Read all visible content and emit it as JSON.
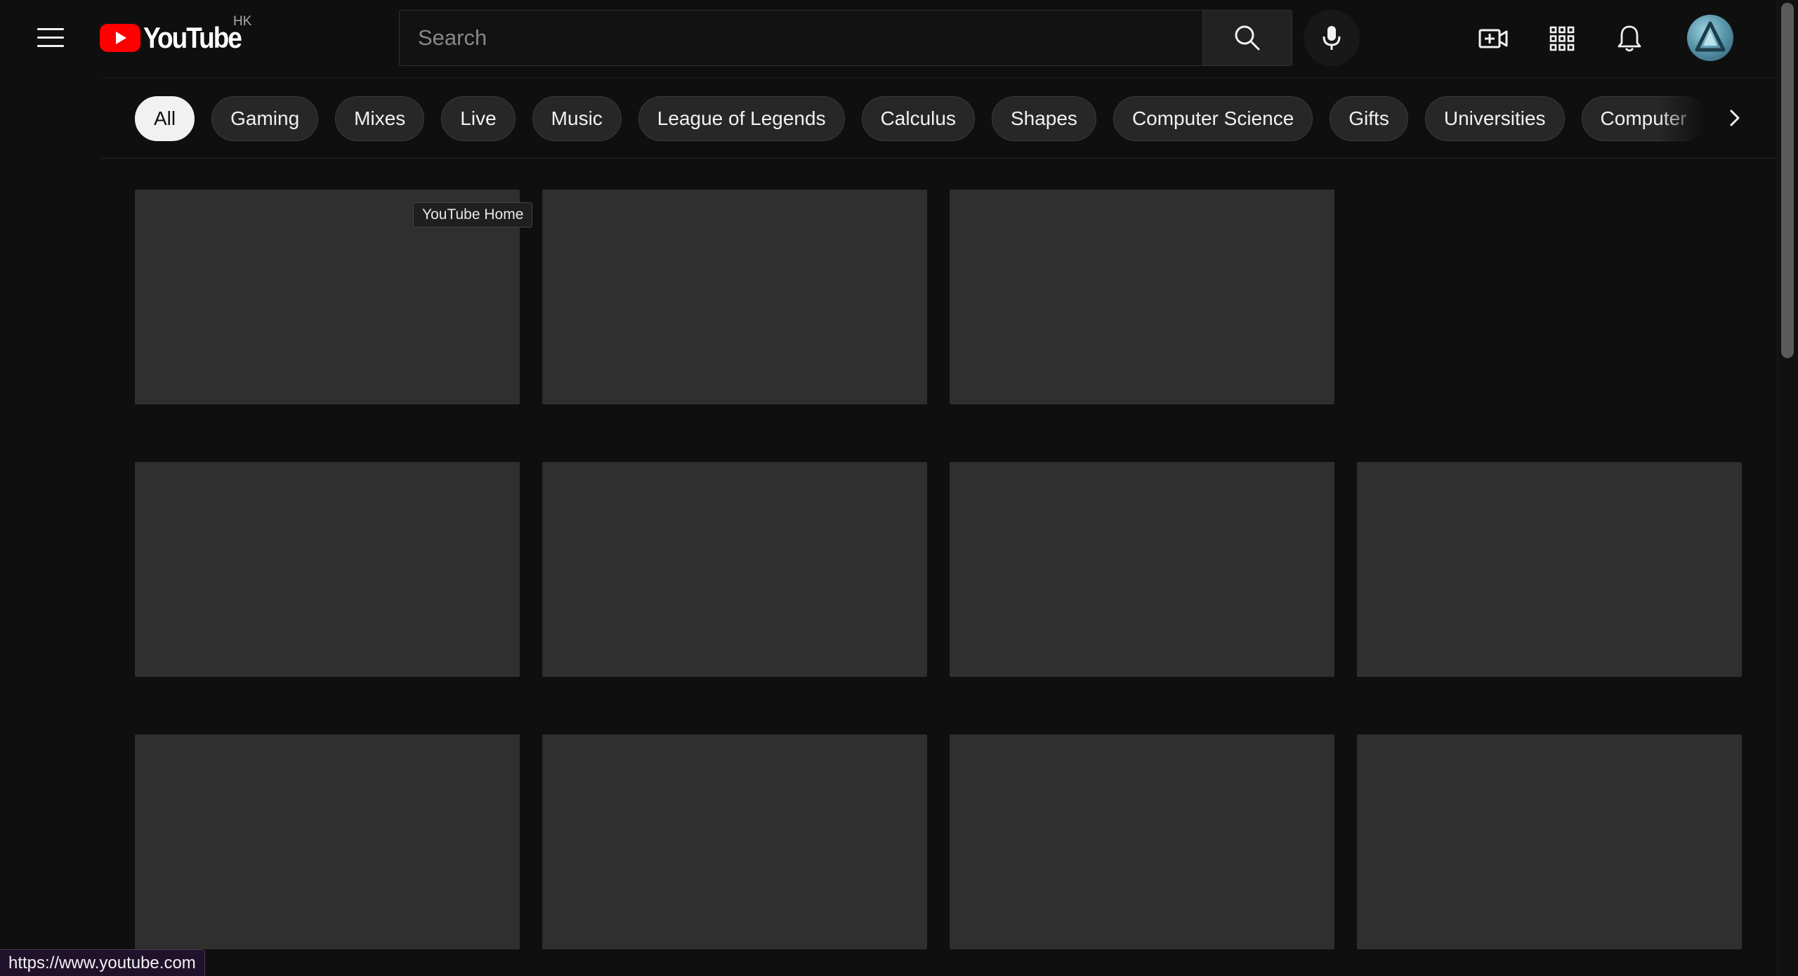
{
  "masthead": {
    "logo_text": "YouTube",
    "country_code": "HK",
    "search_placeholder": "Search",
    "icons": {
      "menu": "hamburger-menu-icon",
      "search": "search-icon",
      "voice": "microphone-icon",
      "create": "create-video-icon",
      "apps": "apps-grid-icon",
      "notifications": "bell-icon"
    }
  },
  "chips": [
    {
      "label": "All",
      "active": true
    },
    {
      "label": "Gaming",
      "active": false
    },
    {
      "label": "Mixes",
      "active": false
    },
    {
      "label": "Live",
      "active": false
    },
    {
      "label": "Music",
      "active": false
    },
    {
      "label": "League of Legends",
      "active": false
    },
    {
      "label": "Calculus",
      "active": false
    },
    {
      "label": "Shapes",
      "active": false
    },
    {
      "label": "Computer Science",
      "active": false
    },
    {
      "label": "Gifts",
      "active": false
    },
    {
      "label": "Universities",
      "active": false
    },
    {
      "label": "Computer",
      "active": false
    }
  ],
  "tooltip": "YouTube Home",
  "status_url": "https://www.youtube.com",
  "colors": {
    "background": "#0f0f0f",
    "placeholder_thumb": "#2f2f2f",
    "logo_red": "#ff0000",
    "chip_bg": "#272727",
    "chip_active_bg": "#f1f1f1"
  }
}
